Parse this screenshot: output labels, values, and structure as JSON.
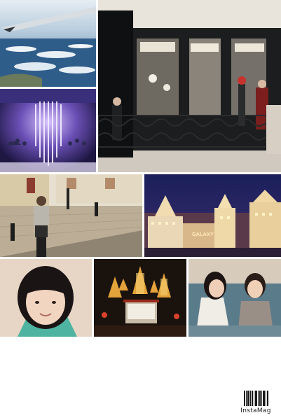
{
  "collage": {
    "photos": [
      {
        "id": "plane-window-view"
      },
      {
        "id": "restaurant-storefront"
      },
      {
        "id": "crystal-chandelier"
      },
      {
        "id": "old-town-street"
      },
      {
        "id": "galaxy-resort-night"
      },
      {
        "id": "selfie-portrait"
      },
      {
        "id": "temple-lanterns"
      },
      {
        "id": "two-friends"
      }
    ]
  },
  "galaxy_sign": "GALAXY",
  "brand": {
    "label": "InstaMag"
  }
}
